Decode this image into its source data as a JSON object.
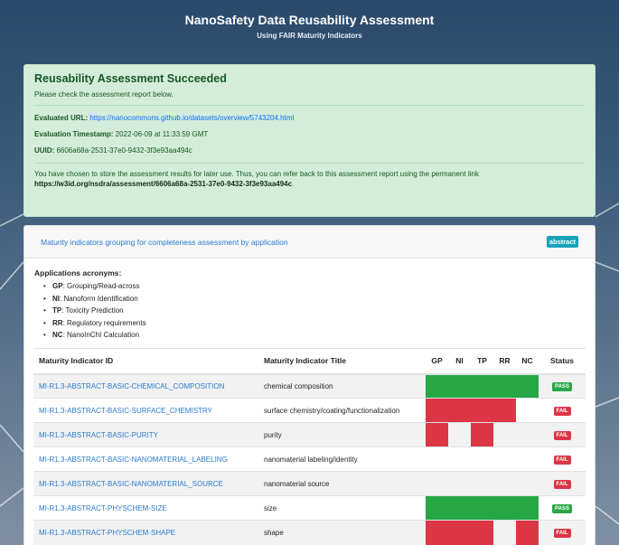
{
  "header": {
    "title": "NanoSafety Data Reusability Assessment",
    "subtitle": "Using FAIR Maturity Indicators"
  },
  "alert": {
    "heading": "Reusability Assessment Succeeded",
    "subtitle": "Please check the assessment report below.",
    "url_label": "Evaluated URL:",
    "url_value": "https://nanocommons.github.io/datasets/overview/5743204.html",
    "timestamp_label": "Evaluation Timestamp:",
    "timestamp_value": "2022-06-09 at 11:33:59 GMT",
    "uuid_label": "UUID:",
    "uuid_value": "6606a68a-2531-37e0-9432-3f3e93aa494c",
    "store_text": "You have chosen to store the assessment results for later use. Thus, you can refer back to this assessment report using the permanent link",
    "permanent_link": "https://w3id.org/nsdra/assessment/6606a68a-2531-37e0-9432-3f3e93aa494c",
    "period": "."
  },
  "card": {
    "header_link": "Maturity indicators grouping for completeness assessment by application",
    "badge": "abstract",
    "acronyms_heading": "Applications acronyms:",
    "acronyms": [
      {
        "code": "GP",
        "desc": ": Grouping/Read-across"
      },
      {
        "code": "NI",
        "desc": ": Nanoform Identification"
      },
      {
        "code": "TP",
        "desc": ": Toxicity Prediction"
      },
      {
        "code": "RR",
        "desc": ": Regulatory requirements"
      },
      {
        "code": "NC",
        "desc": ": NanoInChI Calculation"
      }
    ]
  },
  "table": {
    "columns": [
      "Maturity Indicator ID",
      "Maturity Indicator Title",
      "GP",
      "NI",
      "TP",
      "RR",
      "NC",
      "Status"
    ],
    "rows": [
      {
        "id": "MI-R1.3-ABSTRACT-BASIC-CHEMICAL_COMPOSITION",
        "title": "chemical composition",
        "status": "PASS",
        "apps": [
          "pass",
          "pass",
          "pass",
          "pass",
          "pass"
        ]
      },
      {
        "id": "MI-R1.3-ABSTRACT-BASIC-SURFACE_CHEMISTRY",
        "title": "surface chemistry/coating/functionalization",
        "status": "FAIL",
        "apps": [
          "fail",
          "fail",
          "fail",
          "fail",
          "none"
        ]
      },
      {
        "id": "MI-R1.3-ABSTRACT-BASIC-PURITY",
        "title": "purity",
        "status": "FAIL",
        "apps": [
          "fail",
          "none",
          "fail",
          "none",
          "none"
        ]
      },
      {
        "id": "MI-R1.3-ABSTRACT-BASIC-NANOMATERIAL_LABELING",
        "title": "nanomaterial labeling/identity",
        "status": "FAIL",
        "apps": [
          "none",
          "none",
          "none",
          "none",
          "none"
        ]
      },
      {
        "id": "MI-R1.3-ABSTRACT-BASIC-NANOMATERIAL_SOURCE",
        "title": "nanomaterial source",
        "status": "FAIL",
        "apps": [
          "none",
          "none",
          "none",
          "none",
          "none"
        ]
      },
      {
        "id": "MI-R1.3-ABSTRACT-PHYSCHEM-SIZE",
        "title": "size",
        "status": "PASS",
        "apps": [
          "pass",
          "pass",
          "pass",
          "pass",
          "pass"
        ]
      },
      {
        "id": "MI-R1.3-ABSTRACT-PHYSCHEM-SHAPE",
        "title": "shape",
        "status": "FAIL",
        "apps": [
          "fail",
          "fail",
          "fail",
          "none",
          "fail"
        ]
      }
    ]
  },
  "colors": {
    "pass": "#28a745",
    "fail": "#dc3545",
    "accent": "#17a2b8",
    "link": "#2a7bd1"
  }
}
